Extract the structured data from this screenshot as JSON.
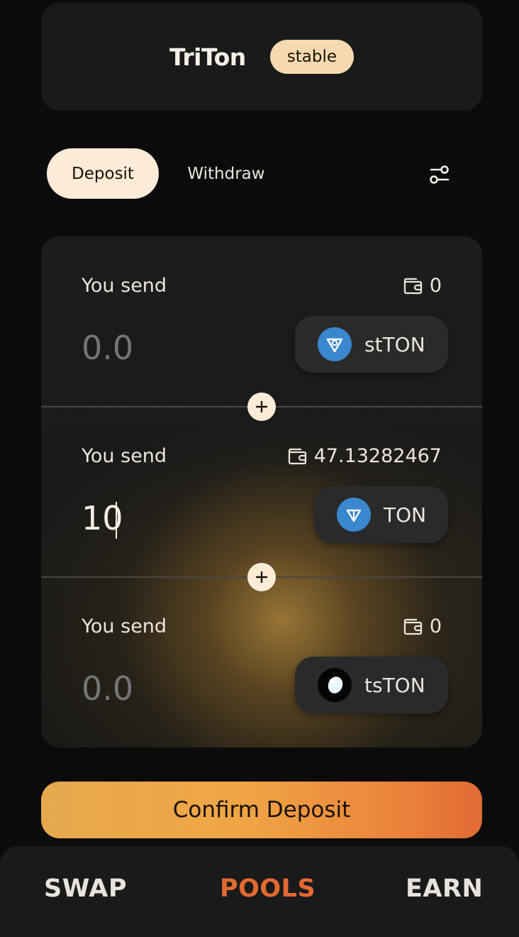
{
  "header": {
    "pool_name": "TriTon",
    "badge": "stable"
  },
  "tabs": {
    "deposit": "Deposit",
    "withdraw": "Withdraw",
    "active": "Deposit"
  },
  "inputs": [
    {
      "label": "You send",
      "balance": "0",
      "amount": "0.0",
      "token": "stTON",
      "token_icon": "stton-icon"
    },
    {
      "label": "You send",
      "balance": "47.13282467",
      "amount": "10",
      "token": "TON",
      "token_icon": "ton-icon"
    },
    {
      "label": "You send",
      "balance": "0",
      "amount": "0.0",
      "token": "tsTON",
      "token_icon": "tston-icon"
    }
  ],
  "confirm": {
    "label": "Confirm Deposit"
  },
  "nav": {
    "swap": "SWAP",
    "pools": "POOLS",
    "earn": "EARN",
    "active": "POOLS"
  },
  "colors": {
    "accent": "#e26a31",
    "badge": "#f6d9b0",
    "ton_blue": "#3a86cf"
  }
}
